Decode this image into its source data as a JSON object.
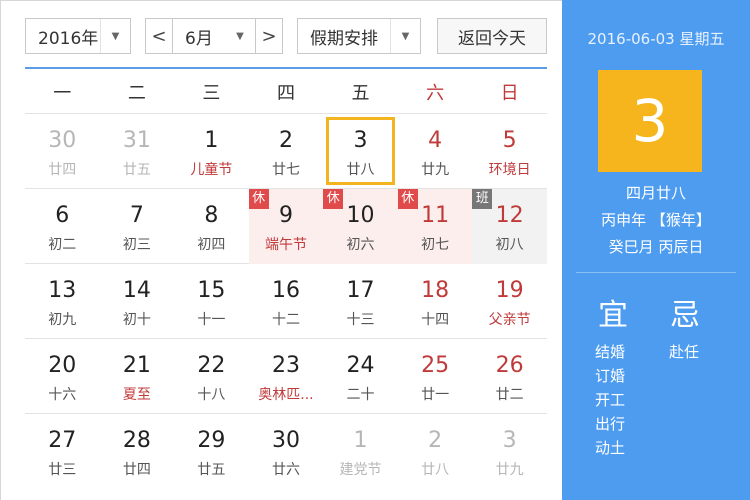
{
  "toolbar": {
    "year": "2016年",
    "month": "6月",
    "prev_symbol": "<",
    "next_symbol": ">",
    "holiday_select": "假期安排",
    "today_button": "返回今天",
    "dropdown_arrow": "▼"
  },
  "weekdays": [
    "一",
    "二",
    "三",
    "四",
    "五",
    "六",
    "日"
  ],
  "weeks": [
    [
      {
        "day": "30",
        "lunar": "廿四"
      },
      {
        "day": "31",
        "lunar": "廿五"
      },
      {
        "day": "1",
        "lunar": "儿童节"
      },
      {
        "day": "2",
        "lunar": "廿七"
      },
      {
        "day": "3",
        "lunar": "廿八"
      },
      {
        "day": "4",
        "lunar": "廿九"
      },
      {
        "day": "5",
        "lunar": "环境日"
      }
    ],
    [
      {
        "day": "6",
        "lunar": "初二"
      },
      {
        "day": "7",
        "lunar": "初三"
      },
      {
        "day": "8",
        "lunar": "初四"
      },
      {
        "day": "9",
        "lunar": "端午节",
        "tag": "休"
      },
      {
        "day": "10",
        "lunar": "初六",
        "tag": "休"
      },
      {
        "day": "11",
        "lunar": "初七",
        "tag": "休"
      },
      {
        "day": "12",
        "lunar": "初八",
        "tag": "班"
      }
    ],
    [
      {
        "day": "13",
        "lunar": "初九"
      },
      {
        "day": "14",
        "lunar": "初十"
      },
      {
        "day": "15",
        "lunar": "十一"
      },
      {
        "day": "16",
        "lunar": "十二"
      },
      {
        "day": "17",
        "lunar": "十三"
      },
      {
        "day": "18",
        "lunar": "十四"
      },
      {
        "day": "19",
        "lunar": "父亲节"
      }
    ],
    [
      {
        "day": "20",
        "lunar": "十六"
      },
      {
        "day": "21",
        "lunar": "夏至"
      },
      {
        "day": "22",
        "lunar": "十八"
      },
      {
        "day": "23",
        "lunar": "奥林匹..."
      },
      {
        "day": "24",
        "lunar": "二十"
      },
      {
        "day": "25",
        "lunar": "廿一"
      },
      {
        "day": "26",
        "lunar": "廿二"
      }
    ],
    [
      {
        "day": "27",
        "lunar": "廿三"
      },
      {
        "day": "28",
        "lunar": "廿四"
      },
      {
        "day": "29",
        "lunar": "廿五"
      },
      {
        "day": "30",
        "lunar": "廿六"
      },
      {
        "day": "1",
        "lunar": "建党节"
      },
      {
        "day": "2",
        "lunar": "廿八"
      },
      {
        "day": "3",
        "lunar": "廿九"
      }
    ]
  ],
  "panel": {
    "date_line": "2016-06-03 星期五",
    "big_day": "3",
    "lunar_date": "四月廿八",
    "year_ganzhi": "丙申年 【猴年】",
    "month_day_ganzhi": "癸巳月 丙辰日",
    "yi_title": "宜",
    "ji_title": "忌",
    "yi_items": [
      "结婚",
      "订婚",
      "开工",
      "出行",
      "动土"
    ],
    "ji_items": [
      "赴任"
    ]
  },
  "colors": {
    "accent_blue": "#4d9cf0",
    "today_yellow": "#f6b51c",
    "holiday_red": "#c03a3a"
  }
}
